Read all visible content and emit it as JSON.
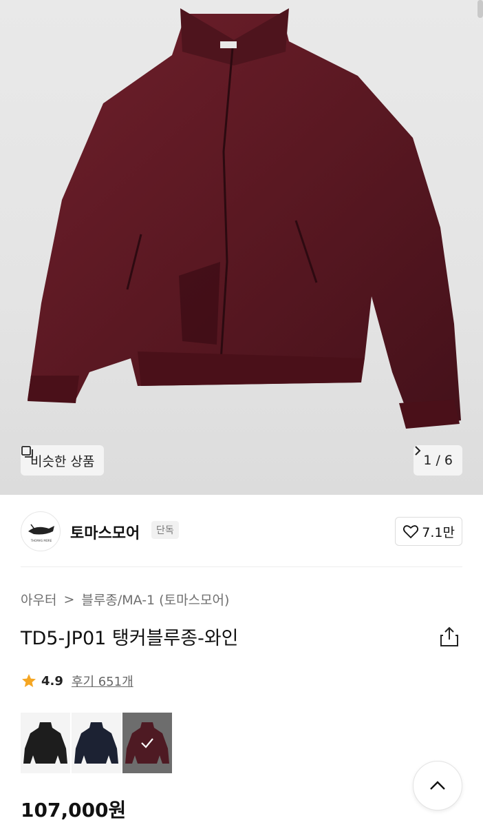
{
  "gallery": {
    "similar_label": "비슷한 상품",
    "pager_text": "1 / 6"
  },
  "brand": {
    "name": "토마스모어",
    "tag": "단독",
    "logo_text": "THOMAS MORE",
    "likes": "7.1만"
  },
  "breadcrumb": {
    "category": "아우터",
    "separator": ">",
    "subcategory": "블루종/MA-1 (토마스모어)"
  },
  "product": {
    "title": "TD5-JP01 탱커블루종-와인",
    "rating": "4.9",
    "reviews": "후기 651개",
    "price": "107,000원"
  },
  "colors": {
    "wine": "#5a1a22",
    "accent_star": "#f5a623",
    "swatches": [
      "black",
      "navy",
      "wine"
    ]
  }
}
